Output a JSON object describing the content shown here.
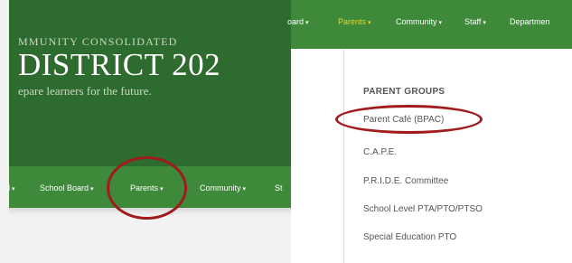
{
  "left": {
    "district_line1": "MMUNITY CONSOLIDATED",
    "district_line2": "DISTRICT 202",
    "tagline": "epare learners for the future.",
    "nav": [
      {
        "label": "l"
      },
      {
        "label": "School Board"
      },
      {
        "label": "Parents"
      },
      {
        "label": "Community"
      },
      {
        "label": "St"
      }
    ],
    "highlighted_item": "Parents"
  },
  "right": {
    "nav": [
      {
        "label": "oard"
      },
      {
        "label": "Parents",
        "active": true
      },
      {
        "label": "Community"
      },
      {
        "label": "Staff"
      },
      {
        "label": "Departmen"
      }
    ],
    "dropdown": {
      "heading": "PARENT GROUPS",
      "items": [
        {
          "label": "Parent Café (BPAC)",
          "highlighted": true
        },
        {
          "label": "C.A.P.E."
        },
        {
          "label": "P.R.I.D.E. Committee"
        },
        {
          "label": "School Level PTA/PTO/PTSO"
        },
        {
          "label": "Special Education PTO"
        }
      ]
    }
  },
  "colors": {
    "banner_green": "#2e6b2e",
    "nav_green": "#3f8a3a",
    "active_nav": "#e8d22a",
    "highlight_red": "#a01b1b"
  },
  "caret": "▾"
}
